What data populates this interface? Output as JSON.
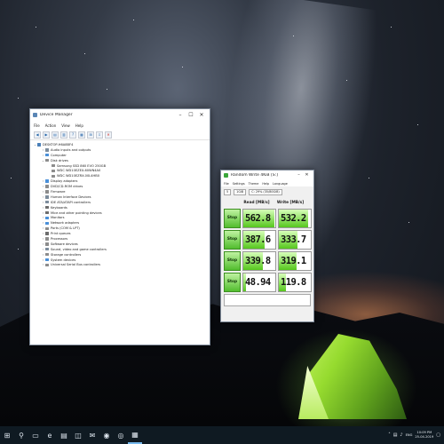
{
  "device_manager": {
    "title": "Device Manager",
    "menu": [
      "File",
      "Action",
      "View",
      "Help"
    ],
    "tree": [
      {
        "label": "DESKTOP-H6A8BF4",
        "level": 0,
        "toggle": "⌄",
        "color": "#4a7fb8"
      },
      {
        "label": "Audio inputs and outputs",
        "level": 1,
        "toggle": "›",
        "color": "#7c8c9c"
      },
      {
        "label": "Computer",
        "level": 1,
        "toggle": "›",
        "color": "#4a90d9"
      },
      {
        "label": "Disk drives",
        "level": 1,
        "toggle": "⌄",
        "color": "#8c8c8c"
      },
      {
        "label": "Samsung SSD 860 EVO 250GB",
        "level": 2,
        "toggle": "",
        "color": "#8c8c8c"
      },
      {
        "label": "WDC WD10EZEX-60WN4A0",
        "level": 2,
        "toggle": "",
        "color": "#8c8c8c"
      },
      {
        "label": "WDC WD10EZRX-00L4HB0",
        "level": 2,
        "toggle": "",
        "color": "#8c8c8c"
      },
      {
        "label": "Display adapters",
        "level": 1,
        "toggle": "›",
        "color": "#4a90d9"
      },
      {
        "label": "DVD/CD-ROM drives",
        "level": 1,
        "toggle": "›",
        "color": "#8c8c8c"
      },
      {
        "label": "Firmware",
        "level": 1,
        "toggle": "›",
        "color": "#8c8c8c"
      },
      {
        "label": "Human Interface Devices",
        "level": 1,
        "toggle": "›",
        "color": "#7c8c9c"
      },
      {
        "label": "IDE ATA/ATAPI controllers",
        "level": 1,
        "toggle": "›",
        "color": "#7c8c9c"
      },
      {
        "label": "Keyboards",
        "level": 1,
        "toggle": "›",
        "color": "#6c6c6c"
      },
      {
        "label": "Mice and other pointing devices",
        "level": 1,
        "toggle": "›",
        "color": "#6c6c6c"
      },
      {
        "label": "Monitors",
        "level": 1,
        "toggle": "›",
        "color": "#4a90d9"
      },
      {
        "label": "Network adapters",
        "level": 1,
        "toggle": "›",
        "color": "#4a90d9"
      },
      {
        "label": "Ports (COM & LPT)",
        "level": 1,
        "toggle": "›",
        "color": "#8c8c8c"
      },
      {
        "label": "Print queues",
        "level": 1,
        "toggle": "›",
        "color": "#6c6c6c"
      },
      {
        "label": "Processors",
        "level": 1,
        "toggle": "›",
        "color": "#8c8c8c"
      },
      {
        "label": "Software devices",
        "level": 1,
        "toggle": "›",
        "color": "#8c8c8c"
      },
      {
        "label": "Sound, video and game controllers",
        "level": 1,
        "toggle": "›",
        "color": "#7c8c9c"
      },
      {
        "label": "Storage controllers",
        "level": 1,
        "toggle": "›",
        "color": "#8c8c8c"
      },
      {
        "label": "System devices",
        "level": 1,
        "toggle": "›",
        "color": "#4a90d9"
      },
      {
        "label": "Universal Serial Bus controllers",
        "level": 1,
        "toggle": "›",
        "color": "#8c8c8c"
      }
    ]
  },
  "crystaldiskmark": {
    "title": "Random Write 4KiB [S:]",
    "menu": [
      "File",
      "Settings",
      "Theme",
      "Help",
      "Language"
    ],
    "count": "5",
    "size": "1GiB",
    "drive": "C: 29% (35/80GiB)",
    "read_header": "Read [MB/s]",
    "write_header": "Write [MB/s]",
    "stop_label": "Stop",
    "rows": [
      {
        "read": "562.8",
        "write": "532.2",
        "read_fill": 0.98,
        "write_fill": 0.93
      },
      {
        "read": "387.6",
        "write": "333.7",
        "read_fill": 0.68,
        "write_fill": 0.59
      },
      {
        "read": "339.8",
        "write": "319.1",
        "read_fill": 0.6,
        "write_fill": 0.56
      },
      {
        "read": "48.94",
        "write": "119.8",
        "read_fill": 0.09,
        "write_fill": 0.21
      }
    ]
  },
  "taskbar": {
    "icons": [
      "windows-logo",
      "search",
      "task-view",
      "edge",
      "file-explorer",
      "store",
      "mail",
      "chrome",
      "obs",
      "crystaldiskmark"
    ],
    "icon_glyphs": [
      "⊞",
      "⚲",
      "▭",
      "e",
      "▤",
      "◫",
      "✉",
      "◉",
      "◎",
      "▦"
    ],
    "language": "ENG",
    "time": "10:09 PM",
    "date": "25-04-2019"
  }
}
